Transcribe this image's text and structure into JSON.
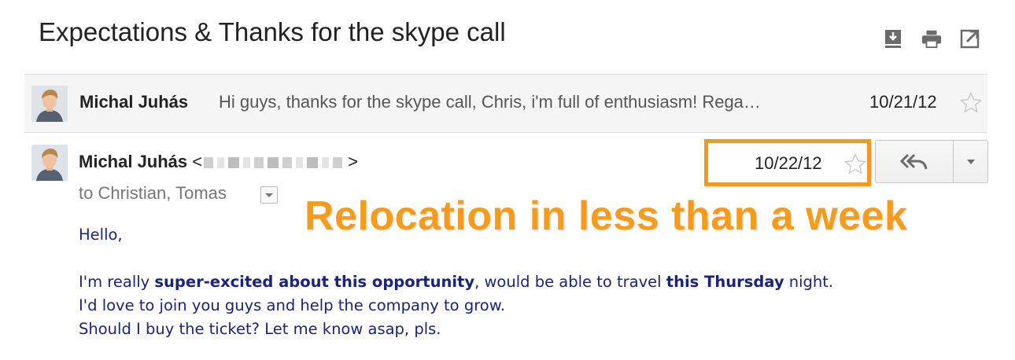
{
  "thread": {
    "subject": "Expectations & Thanks for the skype call",
    "actions": [
      {
        "name": "download-icon"
      },
      {
        "name": "print-icon"
      },
      {
        "name": "open-new-window-icon"
      }
    ]
  },
  "messages": [
    {
      "state": "collapsed",
      "sender": "Michal Juhás",
      "snippet": "Hi guys, thanks for the skype call, Chris, i'm full of enthusiasm! Rega…",
      "date": "10/21/12",
      "starred": false
    },
    {
      "state": "expanded",
      "sender": "Michal Juhás",
      "email_open": "<",
      "email_close": ">",
      "recipients": "to Christian, Tomas",
      "date": "10/22/12",
      "starred": false,
      "body": {
        "greeting": "Hello,",
        "line1_a": "I'm really ",
        "line1_b": "super-excited about this opportunity",
        "line1_c": ", would be able to travel ",
        "line1_d": "this Thursday",
        "line1_e": " night.",
        "line2": "I'd love to join you guys and help the company to grow.",
        "line3": "Should I buy the ticket? Let me know asap, pls."
      }
    }
  ],
  "annotation": {
    "text": "Relocation in less than a week",
    "color": "#f79b1c"
  },
  "colors": {
    "highlight_border": "#f39a1e",
    "body_text": "#1a237e"
  }
}
